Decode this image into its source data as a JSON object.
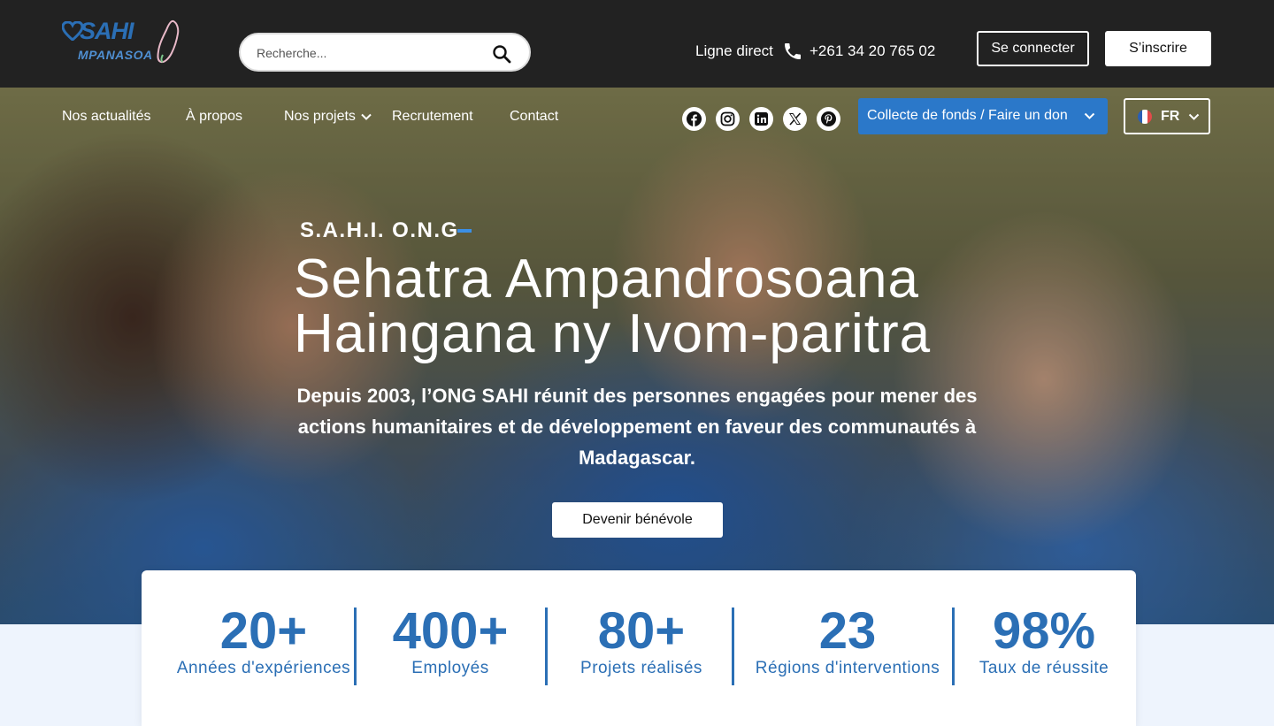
{
  "header": {
    "logo": {
      "name": "SAHI",
      "tagline": "MPANASOA"
    },
    "search": {
      "placeholder": "Recherche..."
    },
    "hotline": {
      "label": "Ligne direct",
      "number": "+261 34 20 765 02"
    },
    "login_label": "Se connecter",
    "signup_label": "S’inscrire"
  },
  "nav": {
    "items": [
      {
        "label": "Nos actualités"
      },
      {
        "label": "À propos"
      },
      {
        "label": "Nos projets",
        "has_dropdown": true
      },
      {
        "label": "Recrutement"
      },
      {
        "label": "Contact"
      }
    ],
    "social": [
      "facebook-icon",
      "instagram-icon",
      "linkedin-icon",
      "x-icon",
      "pinterest-icon"
    ],
    "donate_label": "Collecte de fonds / Faire un don",
    "language": "FR"
  },
  "hero": {
    "kicker": "S.A.H.I. O.N.G",
    "title_line1": "Sehatra Ampandrosoana",
    "title_line2": "Haingana ny Ivom-paritra",
    "description": "Depuis 2003, l’ONG SAHI réunit des personnes engagées pour mener des actions humanitaires et de développement en faveur des communautés à Madagascar.",
    "cta_label": "Devenir bénévole"
  },
  "stats": [
    {
      "value": "20+",
      "label": "Années d'expériences"
    },
    {
      "value": "400+",
      "label": "Employés"
    },
    {
      "value": "80+",
      "label": "Projets réalisés"
    },
    {
      "value": "23",
      "label": "Régions d'interventions"
    },
    {
      "value": "98%",
      "label": "Taux de réussite"
    }
  ],
  "colors": {
    "topbar": "#222222",
    "brand_blue": "#2b6fb5",
    "donate_blue": "#2b78c9",
    "kicker_accent": "#3b8fe6",
    "page_bg": "#eef4fd"
  }
}
